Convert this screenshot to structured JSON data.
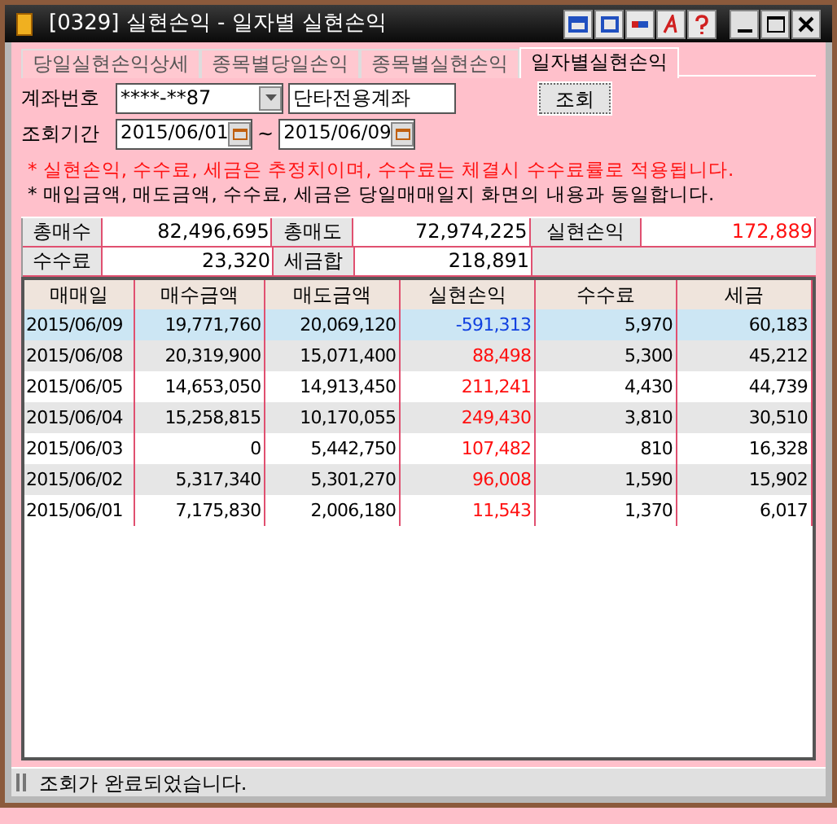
{
  "window": {
    "title": "[0329] 실현손익 - 일자별 실현손익"
  },
  "tabs": [
    {
      "label": "당일실현손익상세",
      "selected": false
    },
    {
      "label": "종목별당일손익",
      "selected": false
    },
    {
      "label": "종목별실현손익",
      "selected": false
    },
    {
      "label": "일자별실현손익",
      "selected": true
    }
  ],
  "account": {
    "label": "계좌번호",
    "value": "****-**87",
    "name": "단타전용계좌"
  },
  "period": {
    "label": "조회기간",
    "from": "2015/06/01",
    "separator": "~",
    "to": "2015/06/09"
  },
  "query_button": "조회",
  "notes": [
    {
      "text": "* 실현손익, 수수료, 세금은 추정치이며, 수수료는 체결시 수수료률로 적용됩니다.",
      "kind": "warning"
    },
    {
      "text": "* 매입금액, 매도금액, 수수료, 세금은 당일매매일지 화면의 내용과 동일합니다.",
      "kind": "info"
    }
  ],
  "summary": [
    [
      {
        "label": "총매수",
        "value": "82,496,695"
      },
      {
        "label": "총매도",
        "value": "72,974,225"
      },
      {
        "label": "실현손익",
        "value": "172,889",
        "color": "#ff1010"
      }
    ],
    [
      {
        "label": "수수료",
        "value": "23,320"
      },
      {
        "label": "세금합",
        "value": "218,891"
      }
    ]
  ],
  "table": {
    "columns": [
      "매매일",
      "매수금액",
      "매도금액",
      "실현손익",
      "수수료",
      "세금"
    ],
    "rows": [
      {
        "cells": [
          "2015/06/09",
          "19,771,760",
          "20,069,120",
          "-591,313",
          "5,970",
          "60,183"
        ],
        "color": "#1040e0",
        "selected": true
      },
      {
        "cells": [
          "2015/06/08",
          "20,319,900",
          "15,071,400",
          "88,498",
          "5,300",
          "45,212"
        ],
        "color": "#ff1010",
        "selected": false
      },
      {
        "cells": [
          "2015/06/05",
          "14,653,050",
          "14,913,450",
          "211,241",
          "4,430",
          "44,739"
        ],
        "color": "#ff1010",
        "selected": false
      },
      {
        "cells": [
          "2015/06/04",
          "15,258,815",
          "10,170,055",
          "249,430",
          "3,810",
          "30,510"
        ],
        "color": "#ff1010",
        "selected": false
      },
      {
        "cells": [
          "2015/06/03",
          "0",
          "5,442,750",
          "107,482",
          "810",
          "16,328"
        ],
        "color": "#ff1010",
        "selected": false
      },
      {
        "cells": [
          "2015/06/02",
          "5,317,340",
          "5,301,270",
          "96,008",
          "1,590",
          "15,902"
        ],
        "color": "#ff1010",
        "selected": false
      },
      {
        "cells": [
          "2015/06/01",
          "7,175,830",
          "2,006,180",
          "11,543",
          "1,370",
          "6,017"
        ],
        "color": "#ff1010",
        "selected": false
      }
    ]
  },
  "status_bar": "조회가 완료되었습니다."
}
